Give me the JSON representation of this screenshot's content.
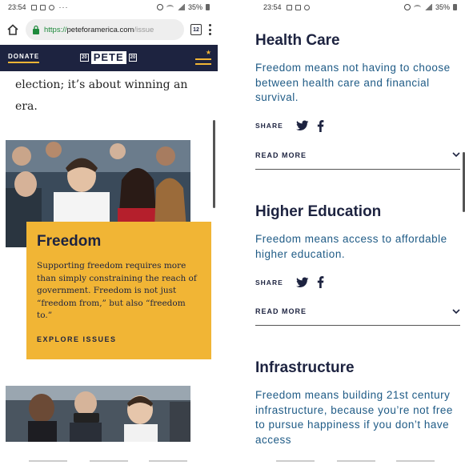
{
  "left": {
    "status": {
      "time": "23:54",
      "battery": "35%",
      "dots": "···"
    },
    "url": {
      "scheme": "https://",
      "host": "peteforamerica.com",
      "path": "/issue"
    },
    "tab_count": "12",
    "nav": {
      "donate": "DONATE",
      "logo": "PETE",
      "year_left": "20",
      "year_right": "20"
    },
    "article_text": "election; it’s about winning an era.",
    "card": {
      "title": "Freedom",
      "description": "Supporting freedom requires more than simply constraining the reach of government. Freedom is not just “freedom from,” but also “freedom to.”",
      "cta": "EXPLORE ISSUES"
    }
  },
  "right": {
    "status": {
      "time": "23:54",
      "battery": "35%"
    },
    "share_label": "SHARE",
    "read_more_label": "READ MORE",
    "issues": [
      {
        "title": "Health Care",
        "description": "Freedom means not having to choose between health care and financial survival."
      },
      {
        "title": "Higher Education",
        "description": "Freedom means access to affordable higher education."
      },
      {
        "title": "Infrastructure",
        "description": "Freedom means building 21st century infrastructure, because you’re not free to pursue happiness if you don’t have access"
      }
    ]
  },
  "colors": {
    "navy": "#1d2340",
    "gold": "#f1b535",
    "teal": "#1f5b86",
    "url_green": "#1e8a3c"
  },
  "icons": [
    "home-icon",
    "lock-icon",
    "tabs-icon",
    "more-menu-icon",
    "hamburger-icon",
    "star-icon",
    "twitter-icon",
    "facebook-icon",
    "chevron-down-icon"
  ]
}
